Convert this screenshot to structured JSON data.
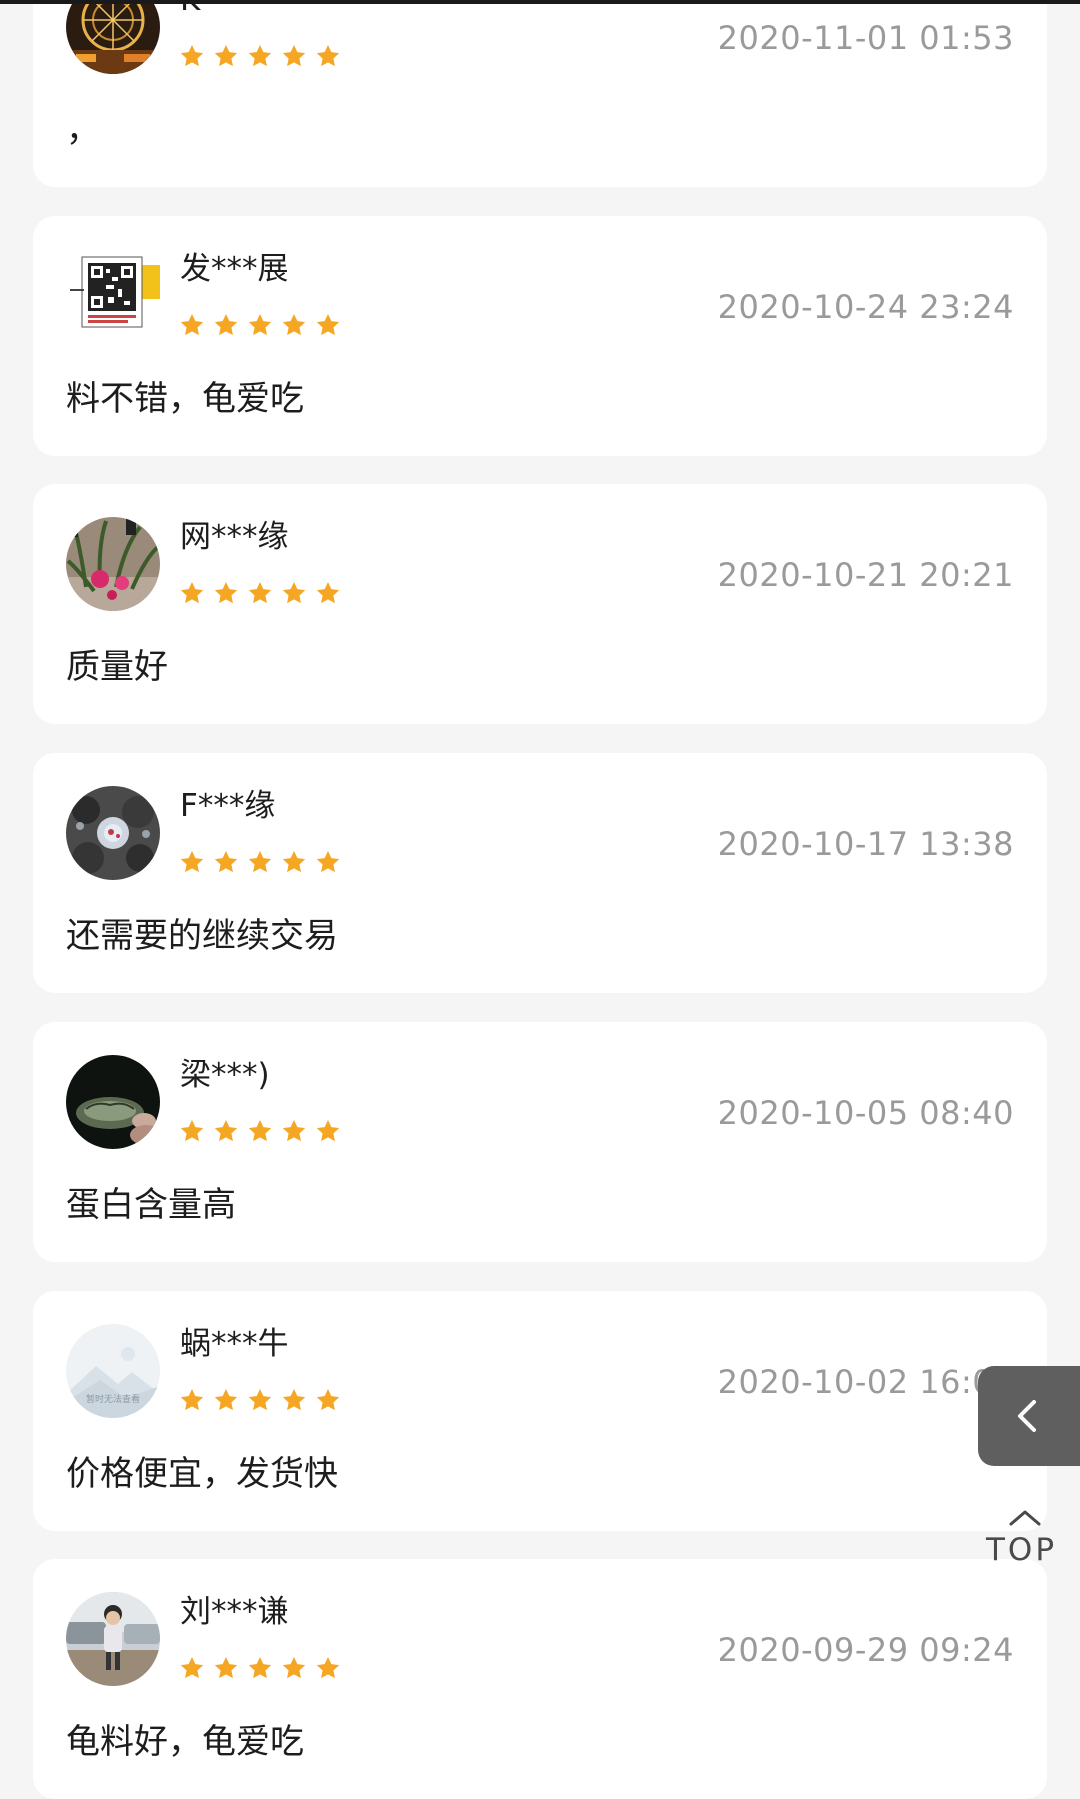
{
  "reviews": [
    {
      "nickname": "K***",
      "rating": 5,
      "date": "2020-11-01 01:53",
      "content": "，",
      "avatar": "ferris-wheel-avatar"
    },
    {
      "nickname": "发***展",
      "rating": 5,
      "date": "2020-10-24 23:24",
      "content": "料不错，龟爱吃",
      "avatar": "qr-code-avatar"
    },
    {
      "nickname": "网***缘",
      "rating": 5,
      "date": "2020-10-21 20:21",
      "content": "质量好",
      "avatar": "plant-avatar"
    },
    {
      "nickname": "F***缘",
      "rating": 5,
      "date": "2020-10-17 13:38",
      "content": "还需要的继续交易",
      "avatar": "crystal-avatar"
    },
    {
      "nickname": "梁***)",
      "rating": 5,
      "date": "2020-10-05 08:40",
      "content": "蛋白含量高",
      "avatar": "turtle-avatar"
    },
    {
      "nickname": "蜗***牛",
      "rating": 5,
      "date": "2020-10-02 16:07",
      "content": "价格便宜，发货快",
      "avatar": "placeholder-avatar",
      "avatar_text": "暂时无法查看"
    },
    {
      "nickname": "刘***谦",
      "rating": 5,
      "date": "2020-09-29 09:24",
      "content": "龟料好，龟爱吃",
      "avatar": "child-photo-avatar"
    }
  ],
  "floating": {
    "back_icon": "chevron-left-icon",
    "top_label": "TOP",
    "top_icon": "chevron-up-icon"
  },
  "colors": {
    "star": "#f5a623",
    "date": "#9a9a9a",
    "card": "#ffffff",
    "page": "#f5f5f5",
    "back_button": "#5f5f5f"
  }
}
